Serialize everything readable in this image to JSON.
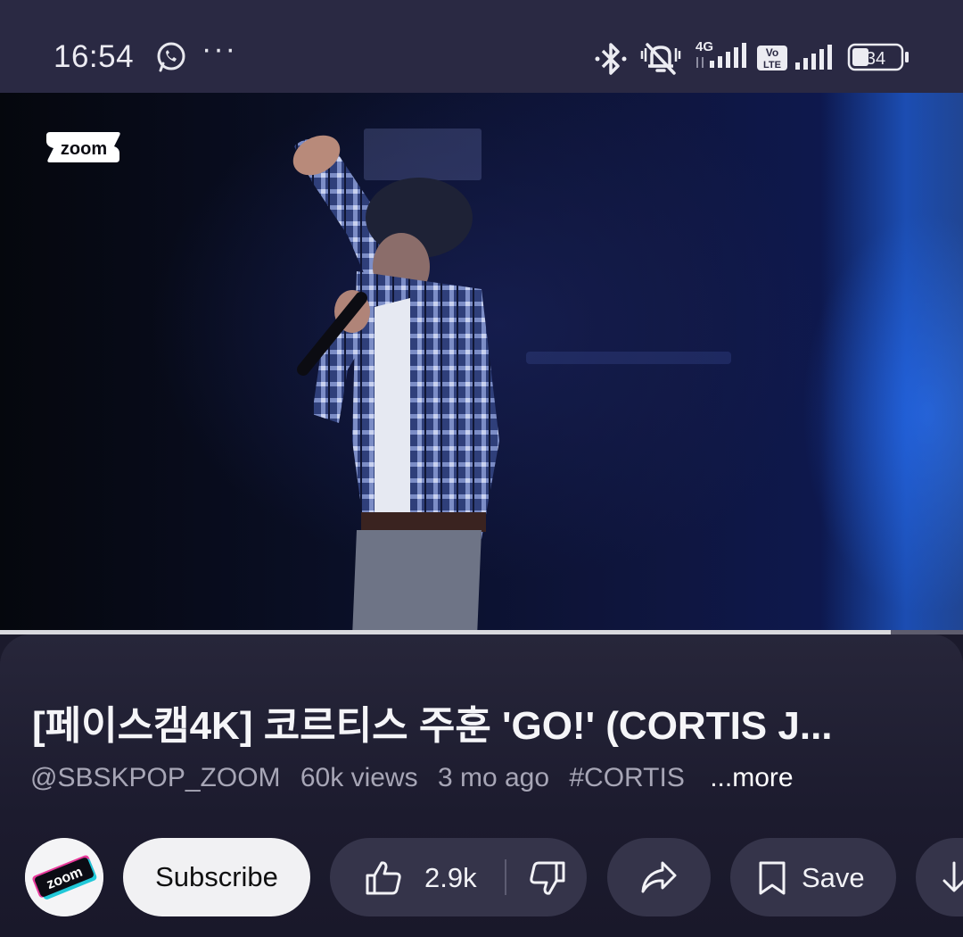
{
  "status_bar": {
    "time": "16:54",
    "icons": [
      "whatsapp-icon",
      "more-dots-icon",
      "bluetooth-icon",
      "silent-bell-icon",
      "4g-signal-icon",
      "volte-icon",
      "signal-icon",
      "battery-icon"
    ],
    "more": "···",
    "network": "4G",
    "volte_top": "Vo",
    "volte_bottom": "LTE",
    "battery": "34"
  },
  "video": {
    "logo_text": "zoom",
    "progress": 0.925
  },
  "info": {
    "title": "[페이스캠4K] 코르티스 주훈 'GO!' (CORTIS J...",
    "channel": "@SBSKPOP_ZOOM",
    "views": "60k views",
    "age": "3 mo ago",
    "hashtag": "#CORTIS",
    "more": "...more"
  },
  "actions": {
    "avatar_text": "zoom",
    "subscribe": "Subscribe",
    "likes": "2.9k",
    "save": "Save"
  },
  "colors": {
    "status_bar_bg": "#2a2943",
    "page_bg": "#1b1a2c",
    "pill_bg": "#35344a",
    "subscribe_bg": "#f1f1f3",
    "meta_text": "#a7a6b6"
  }
}
